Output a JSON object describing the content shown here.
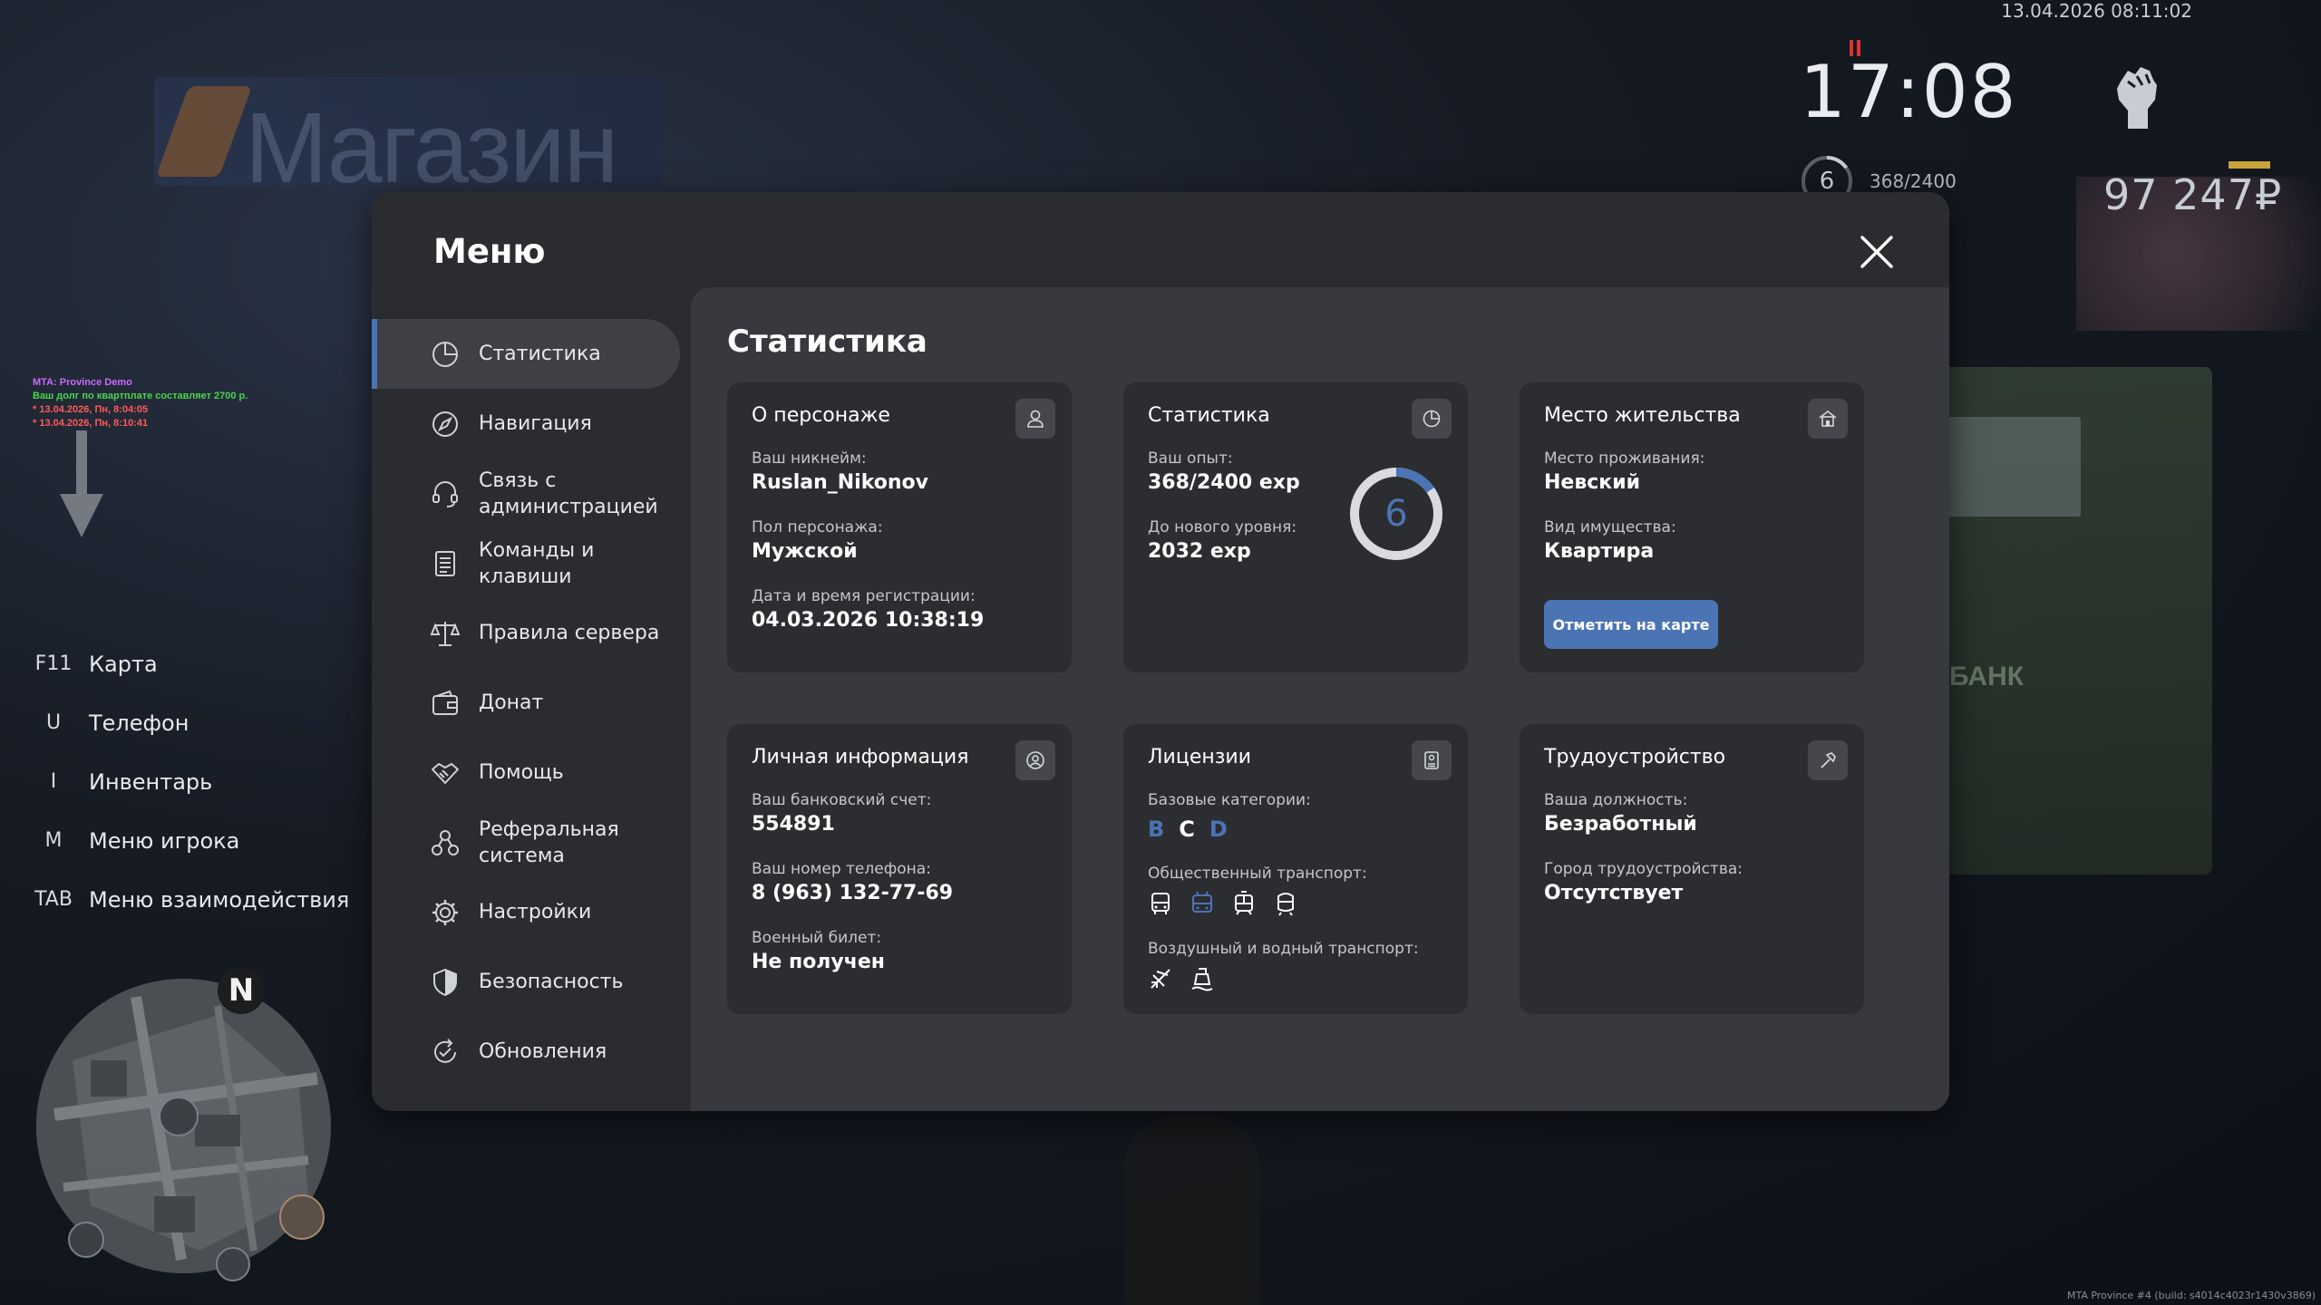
{
  "hud": {
    "datetime": "13.04.2026 08:11:02",
    "clock": "17:08",
    "level": "6",
    "exp": "368/2400",
    "money": "97 247₽"
  },
  "chat": [
    "MTA: Province Demo",
    "Ваш долг по квартплате составляет 2700 р.",
    "* 13.04.2026, Пн, 8:04:05",
    "* 13.04.2026, Пн, 8:10:41"
  ],
  "keys": [
    {
      "key": "F11",
      "label": "Карта"
    },
    {
      "key": "U",
      "label": "Телефон"
    },
    {
      "key": "I",
      "label": "Инвентарь"
    },
    {
      "key": "M",
      "label": "Меню игрока"
    },
    {
      "key": "TAB",
      "label": "Меню взаимодействия"
    }
  ],
  "minimap": {
    "north": "N"
  },
  "build": "MTA Province #4 (build: s4014c4023r1430v3869)",
  "scene": {
    "shop_sign": "Магазин",
    "bank_sign": "БАНК"
  },
  "menu": {
    "title": "Меню",
    "sidebar": [
      {
        "label": "Статистика",
        "icon": "pie-chart-icon",
        "active": true
      },
      {
        "label": "Навигация",
        "icon": "compass-icon"
      },
      {
        "label": "Связь с администрацией",
        "icon": "headset-icon"
      },
      {
        "label": "Команды и клавиши",
        "icon": "document-icon"
      },
      {
        "label": "Правила сервера",
        "icon": "scales-icon"
      },
      {
        "label": "Донат",
        "icon": "wallet-icon"
      },
      {
        "label": "Помощь",
        "icon": "handshake-icon"
      },
      {
        "label": "Реферальная система",
        "icon": "referral-icon"
      },
      {
        "label": "Настройки",
        "icon": "gear-icon"
      },
      {
        "label": "Безопасность",
        "icon": "shield-icon"
      },
      {
        "label": "Обновления",
        "icon": "refresh-check-icon"
      }
    ],
    "content": {
      "title": "Статистика",
      "character": {
        "title": "О персонаже",
        "nickname_label": "Ваш никнейм:",
        "nickname": "Ruslan_Nikonov",
        "gender_label": "Пол персонажа:",
        "gender": "Мужской",
        "reg_label": "Дата и время регистрации:",
        "reg": "04.03.2026 10:38:19"
      },
      "stats": {
        "title": "Статистика",
        "exp_label": "Ваш опыт:",
        "exp": "368/2400 exp",
        "next_label": "До нового уровня:",
        "next": "2032 exp",
        "level": "6",
        "progress": 0.153
      },
      "residence": {
        "title": "Место жительства",
        "place_label": "Место проживания:",
        "place": "Невский",
        "type_label": "Вид имущества:",
        "type": "Квартира",
        "map_button": "Отметить на карте"
      },
      "personal": {
        "title": "Личная информация",
        "bank_label": "Ваш банковский счет:",
        "bank": "554891",
        "phone_label": "Ваш номер телефона:",
        "phone": "8 (963) 132-77-69",
        "military_label": "Военный билет:",
        "military": "Не получен"
      },
      "licenses": {
        "title": "Лицензии",
        "base_label": "Базовые категории:",
        "categories": [
          "B",
          "C",
          "D"
        ],
        "public_label": "Общественный транспорт:",
        "air_label": "Воздушный и водный транспорт:"
      },
      "employment": {
        "title": "Трудоустройство",
        "position_label": "Ваша должность:",
        "position": "Безработный",
        "city_label": "Город трудоустройства:",
        "city": "Отсутствует"
      }
    }
  },
  "colors": {
    "accent": "#4b74b5",
    "window": "#2b2c30",
    "pane": "#38393e",
    "card": "#2c2d31"
  }
}
